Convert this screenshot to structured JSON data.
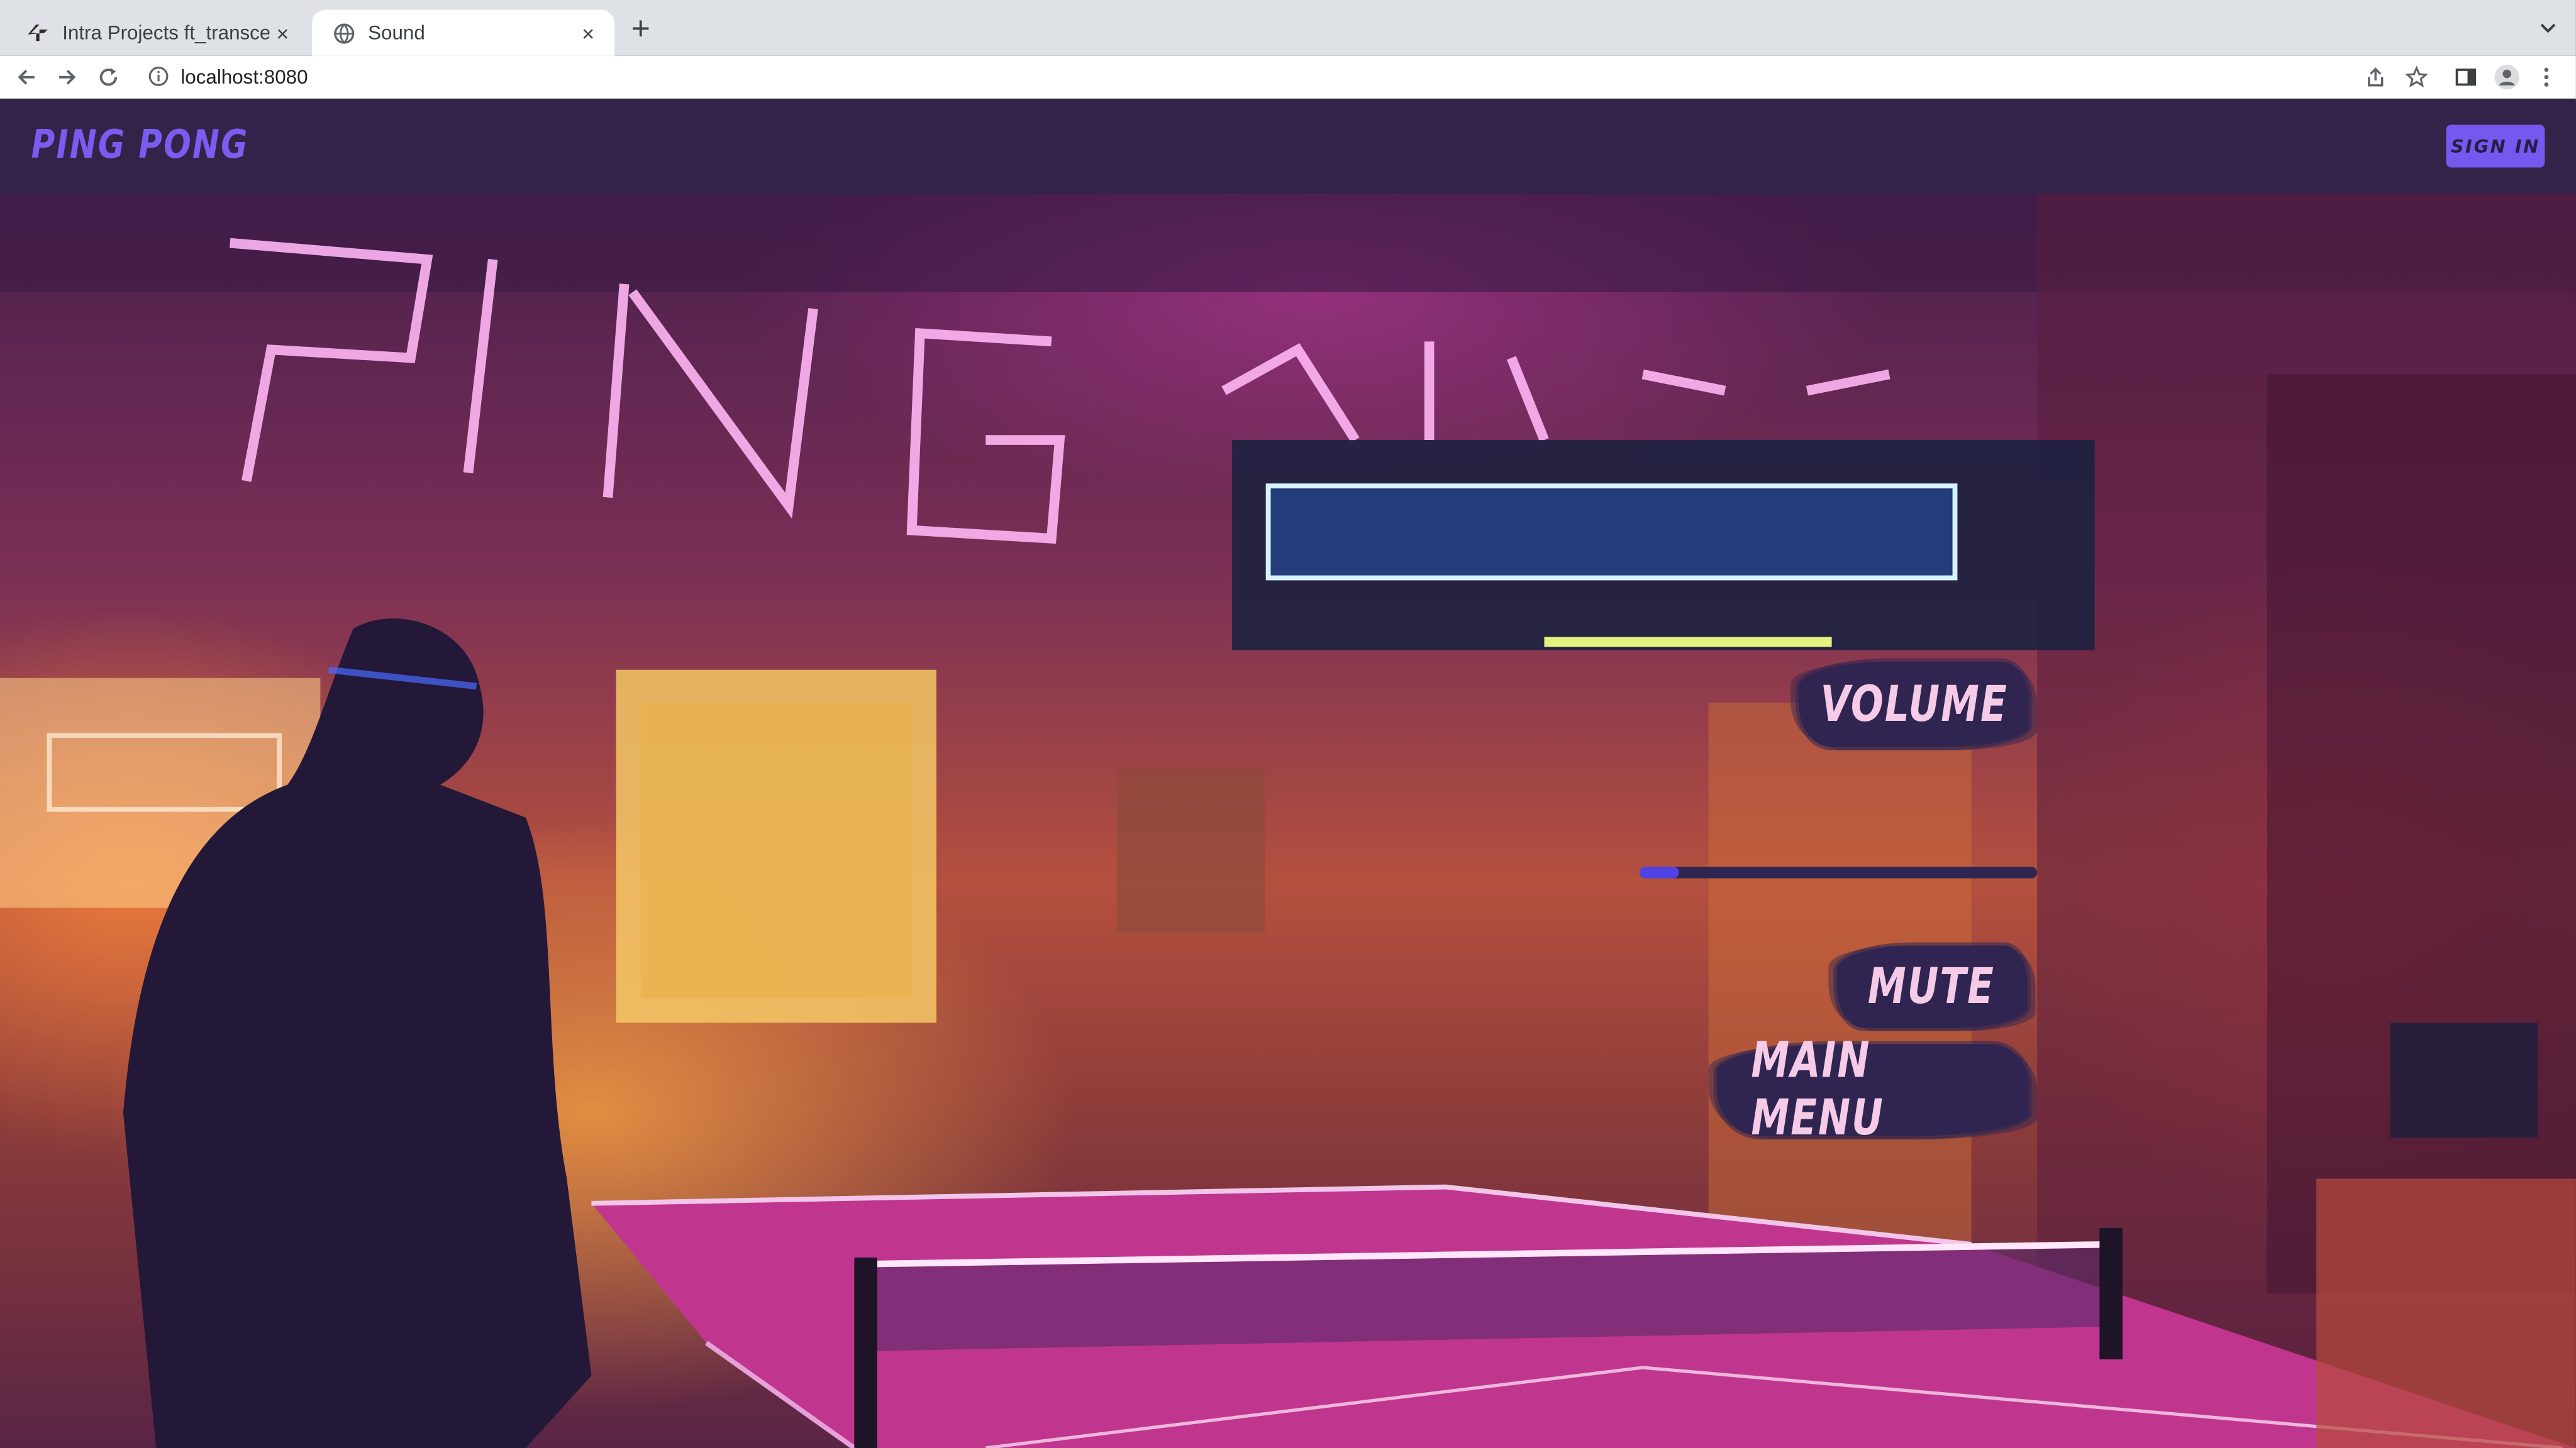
{
  "browser": {
    "tabs": [
      {
        "title": "Intra Projects ft_transcendence",
        "active": false
      },
      {
        "title": "Sound",
        "active": true
      }
    ],
    "new_tab": "+",
    "close_glyph": "×",
    "url": "localhost:8080"
  },
  "page": {
    "brand": "PING PONG",
    "sign_in": "SIGN IN",
    "menu": {
      "volume_label": "VOLUME",
      "volume_value": 0.1,
      "mute_label": "MUTE",
      "main_menu_label": "MAIN MENU"
    }
  },
  "colors": {
    "navbar": "#322448",
    "brand": "#7b5cf0",
    "button": "#7658ee",
    "menu_bg": "#2f2550",
    "menu_text": "#f6cbe8",
    "slider_fill": "#4f43e6"
  }
}
